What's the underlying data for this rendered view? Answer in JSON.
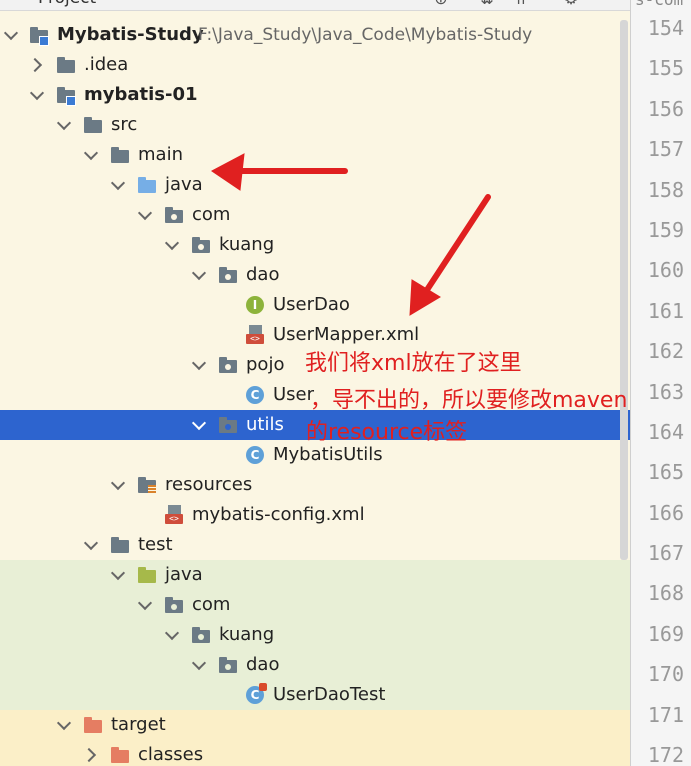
{
  "panel": {
    "title": "Project"
  },
  "gutter": {
    "top_text": "s-com",
    "line_numbers": [
      "154",
      "155",
      "156",
      "157",
      "158",
      "159",
      "160",
      "161",
      "162",
      "163",
      "164",
      "165",
      "166",
      "167",
      "168",
      "169",
      "170",
      "171",
      "172"
    ]
  },
  "tree": {
    "root": {
      "name": "Mybatis-Study",
      "path": "F:\\Java_Study\\Java_Code\\Mybatis-Study"
    },
    "idea": ".idea",
    "module": "mybatis-01",
    "src": "src",
    "main": "main",
    "main_java": "java",
    "main_com": "com",
    "main_kuang": "kuang",
    "main_dao": "dao",
    "userdao": "UserDao",
    "usermapper": "UserMapper.xml",
    "pojo": "pojo",
    "user": "User",
    "utils": "utils",
    "mybatisutils": "MybatisUtils",
    "resources": "resources",
    "mybatis_config": "mybatis-config.xml",
    "test": "test",
    "test_java": "java",
    "test_com": "com",
    "test_kuang": "kuang",
    "test_dao": "dao",
    "userdaotest": "UserDaoTest",
    "target": "target",
    "classes": "classes"
  },
  "annotation": {
    "line1": "我们将xml放在了这里",
    "line2": "，导不出的，所以要修改maven",
    "line3": "的resource标签",
    "color": "#e02020"
  },
  "colors": {
    "selection": "#2d64cf",
    "background": "#fbf6e3",
    "test_bg": "#e8efd6",
    "target_bg": "#fbefc8"
  }
}
